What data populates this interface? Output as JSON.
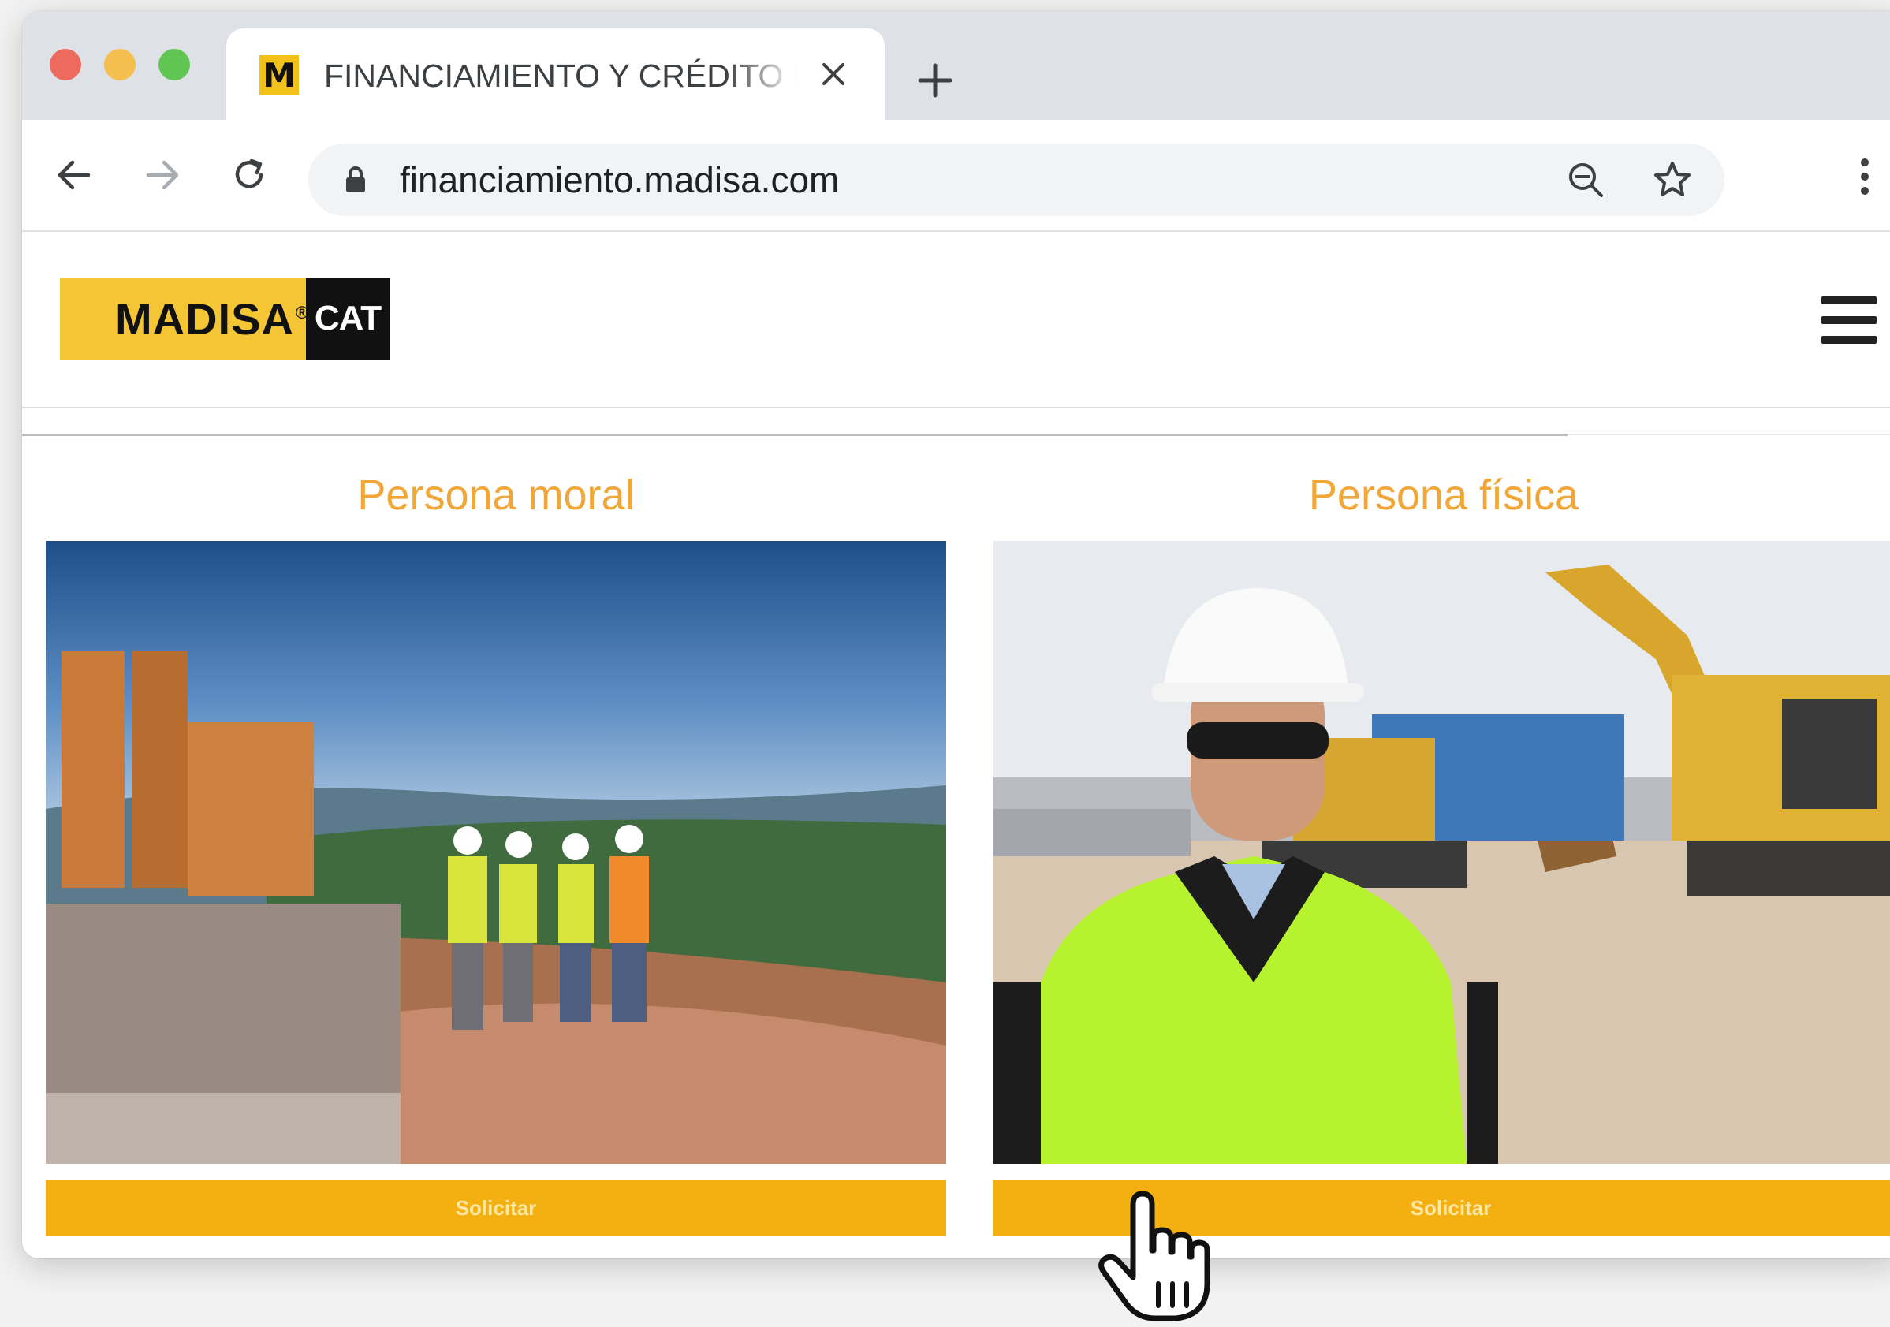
{
  "browser": {
    "tab": {
      "favicon_letter": "M",
      "title": "FINANCIAMIENTO Y CRÉDITO I"
    },
    "url": "financiamiento.madisa.com",
    "icons": [
      "back-icon",
      "forward-icon",
      "reload-icon",
      "lock-icon",
      "zoom-out-icon",
      "star-icon",
      "menu-icon",
      "close-icon",
      "plus-icon"
    ]
  },
  "site": {
    "logo": {
      "brand": "MADISA",
      "reg": "®",
      "cat": "CAT"
    }
  },
  "cards": [
    {
      "title": "Persona moral",
      "button": "Solicitar"
    },
    {
      "title": "Persona física",
      "button": "Solicitar"
    }
  ],
  "colors": {
    "accent": "#f4b010",
    "title": "#f1a737",
    "logo_yellow": "#f4c534"
  }
}
